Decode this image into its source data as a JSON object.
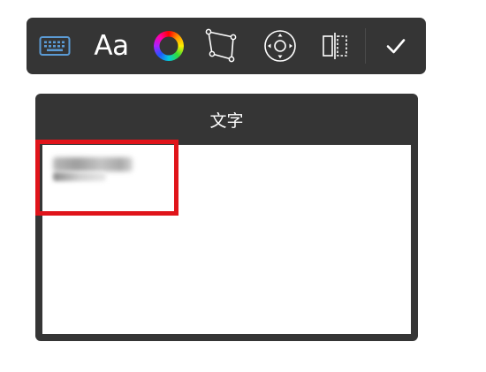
{
  "toolbar": {
    "font_label": "Aa",
    "icons": [
      "keyboard-icon",
      "font-icon",
      "color-wheel-icon",
      "transform-icon",
      "position-icon",
      "flip-icon",
      "checkmark-icon"
    ],
    "keyboard_color": "#5b9bd5"
  },
  "panel": {
    "title": "文字"
  },
  "colors": {
    "toolbar_bg": "#353535",
    "panel_bg": "#353535",
    "highlight": "#e0141a"
  }
}
